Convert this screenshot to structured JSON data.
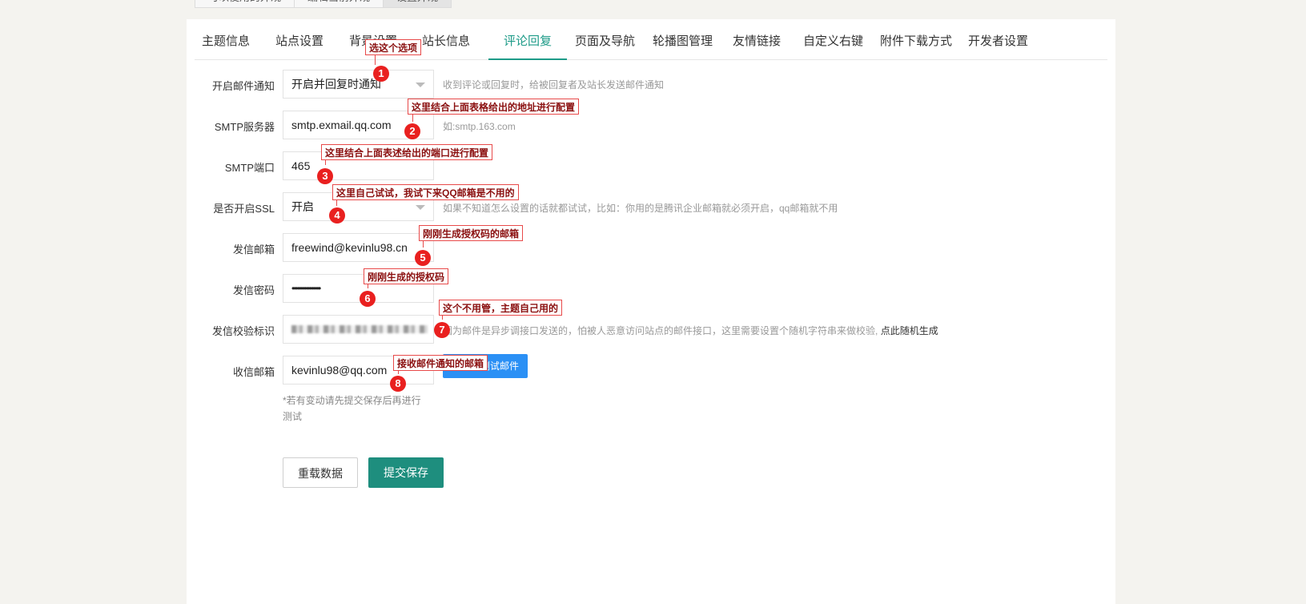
{
  "top_tabs": [
    "可以使用的外观",
    "编辑当前外观",
    "设置外观"
  ],
  "nav": {
    "tabs": [
      "主题信息",
      "站点设置",
      "背景设置",
      "站长信息",
      "评论回复",
      "页面及导航",
      "轮播图管理",
      "友情链接",
      "自定义右键",
      "附件下载方式",
      "开发者设置"
    ],
    "active": "评论回复"
  },
  "form": {
    "mail_notify": {
      "label": "开启邮件通知",
      "value": "开启并回复时通知",
      "hint": "收到评论或回复时，给被回复者及站长发送邮件通知"
    },
    "smtp_server": {
      "label": "SMTP服务器",
      "value": "smtp.exmail.qq.com",
      "hint": "如:smtp.163.com"
    },
    "smtp_port": {
      "label": "SMTP端口",
      "value": "465"
    },
    "ssl": {
      "label": "是否开启SSL",
      "value": "开启",
      "hint": "如果不知道怎么设置的话就都试试，比如：你用的是腾讯企业邮箱就必须开启，qq邮箱就不用"
    },
    "sender_email": {
      "label": "发信邮箱",
      "value": "freewind@kevinlu98.cn"
    },
    "sender_password": {
      "label": "发信密码",
      "value": "••••••••••••••••"
    },
    "verify_token": {
      "label": "发信校验标识",
      "hint": "因为邮件是异步调接口发送的，怕被人恶意访问站点的邮件接口，这里需要设置个随机字符串来做校验,",
      "hint_link": "点此随机生成"
    },
    "receiver_email": {
      "label": "收信邮箱",
      "value": "kevinlu98@qq.com"
    }
  },
  "buttons": {
    "test_mail": "发一封测试邮件",
    "reload": "重载数据",
    "submit": "提交保存"
  },
  "note": "*若有变动请先提交保存后再进行测试",
  "annotations": [
    {
      "num": "1",
      "text": "选这个选项"
    },
    {
      "num": "2",
      "text": "这里结合上面表格给出的地址进行配置"
    },
    {
      "num": "3",
      "text": "这里结合上面表述给出的端口进行配置"
    },
    {
      "num": "4",
      "text": "这里自己试试，我试下来QQ邮箱是不用的"
    },
    {
      "num": "5",
      "text": "刚刚生成授权码的邮箱"
    },
    {
      "num": "6",
      "text": "刚刚生成的授权码"
    },
    {
      "num": "7",
      "text": "这个不用管，主题自己用的"
    },
    {
      "num": "8",
      "text": "接收邮件通知的邮箱"
    }
  ],
  "colors": {
    "accent": "#1e9b88",
    "submit": "#1e8e7e",
    "test_button": "#2b90f5",
    "annotation": "#e9201f"
  }
}
